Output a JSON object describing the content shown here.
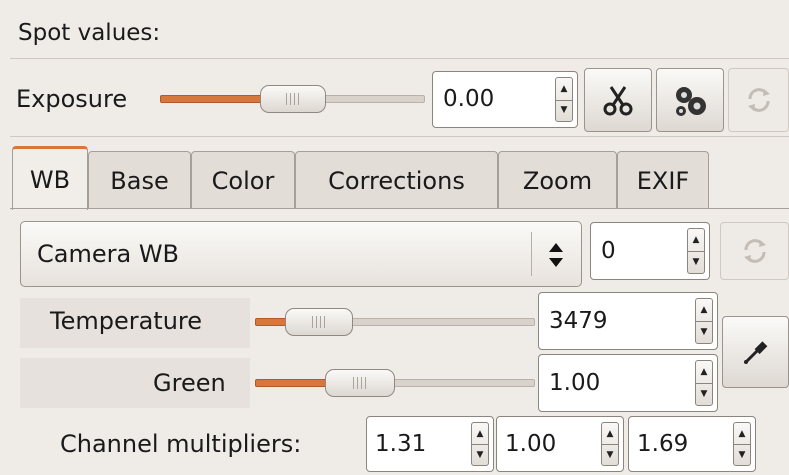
{
  "spot": {
    "label": "Spot values:"
  },
  "exposure": {
    "label": "Exposure",
    "value": "0.00",
    "slider_fraction": 0.5
  },
  "toolbar": {
    "cut_icon": "scissors-icon",
    "settings_icon": "gears-icon",
    "reset_icon": "refresh-icon"
  },
  "tabs": [
    {
      "label": "WB",
      "active": true
    },
    {
      "label": "Base"
    },
    {
      "label": "Color"
    },
    {
      "label": "Corrections"
    },
    {
      "label": "Zoom"
    },
    {
      "label": "EXIF"
    }
  ],
  "wb": {
    "preset": "Camera WB",
    "preset_spin": "0",
    "temperature": {
      "label": "Temperature",
      "value": "3479",
      "slider_fraction": 0.2
    },
    "green": {
      "label": "Green",
      "value": "1.00",
      "slider_fraction": 0.3
    },
    "channel_multipliers": {
      "label": "Channel multipliers:",
      "values": [
        "1.31",
        "1.00",
        "1.69"
      ]
    },
    "picker_icon": "eyedropper-icon"
  },
  "colors": {
    "accent": "#d8763e",
    "background": "#efebe7"
  }
}
